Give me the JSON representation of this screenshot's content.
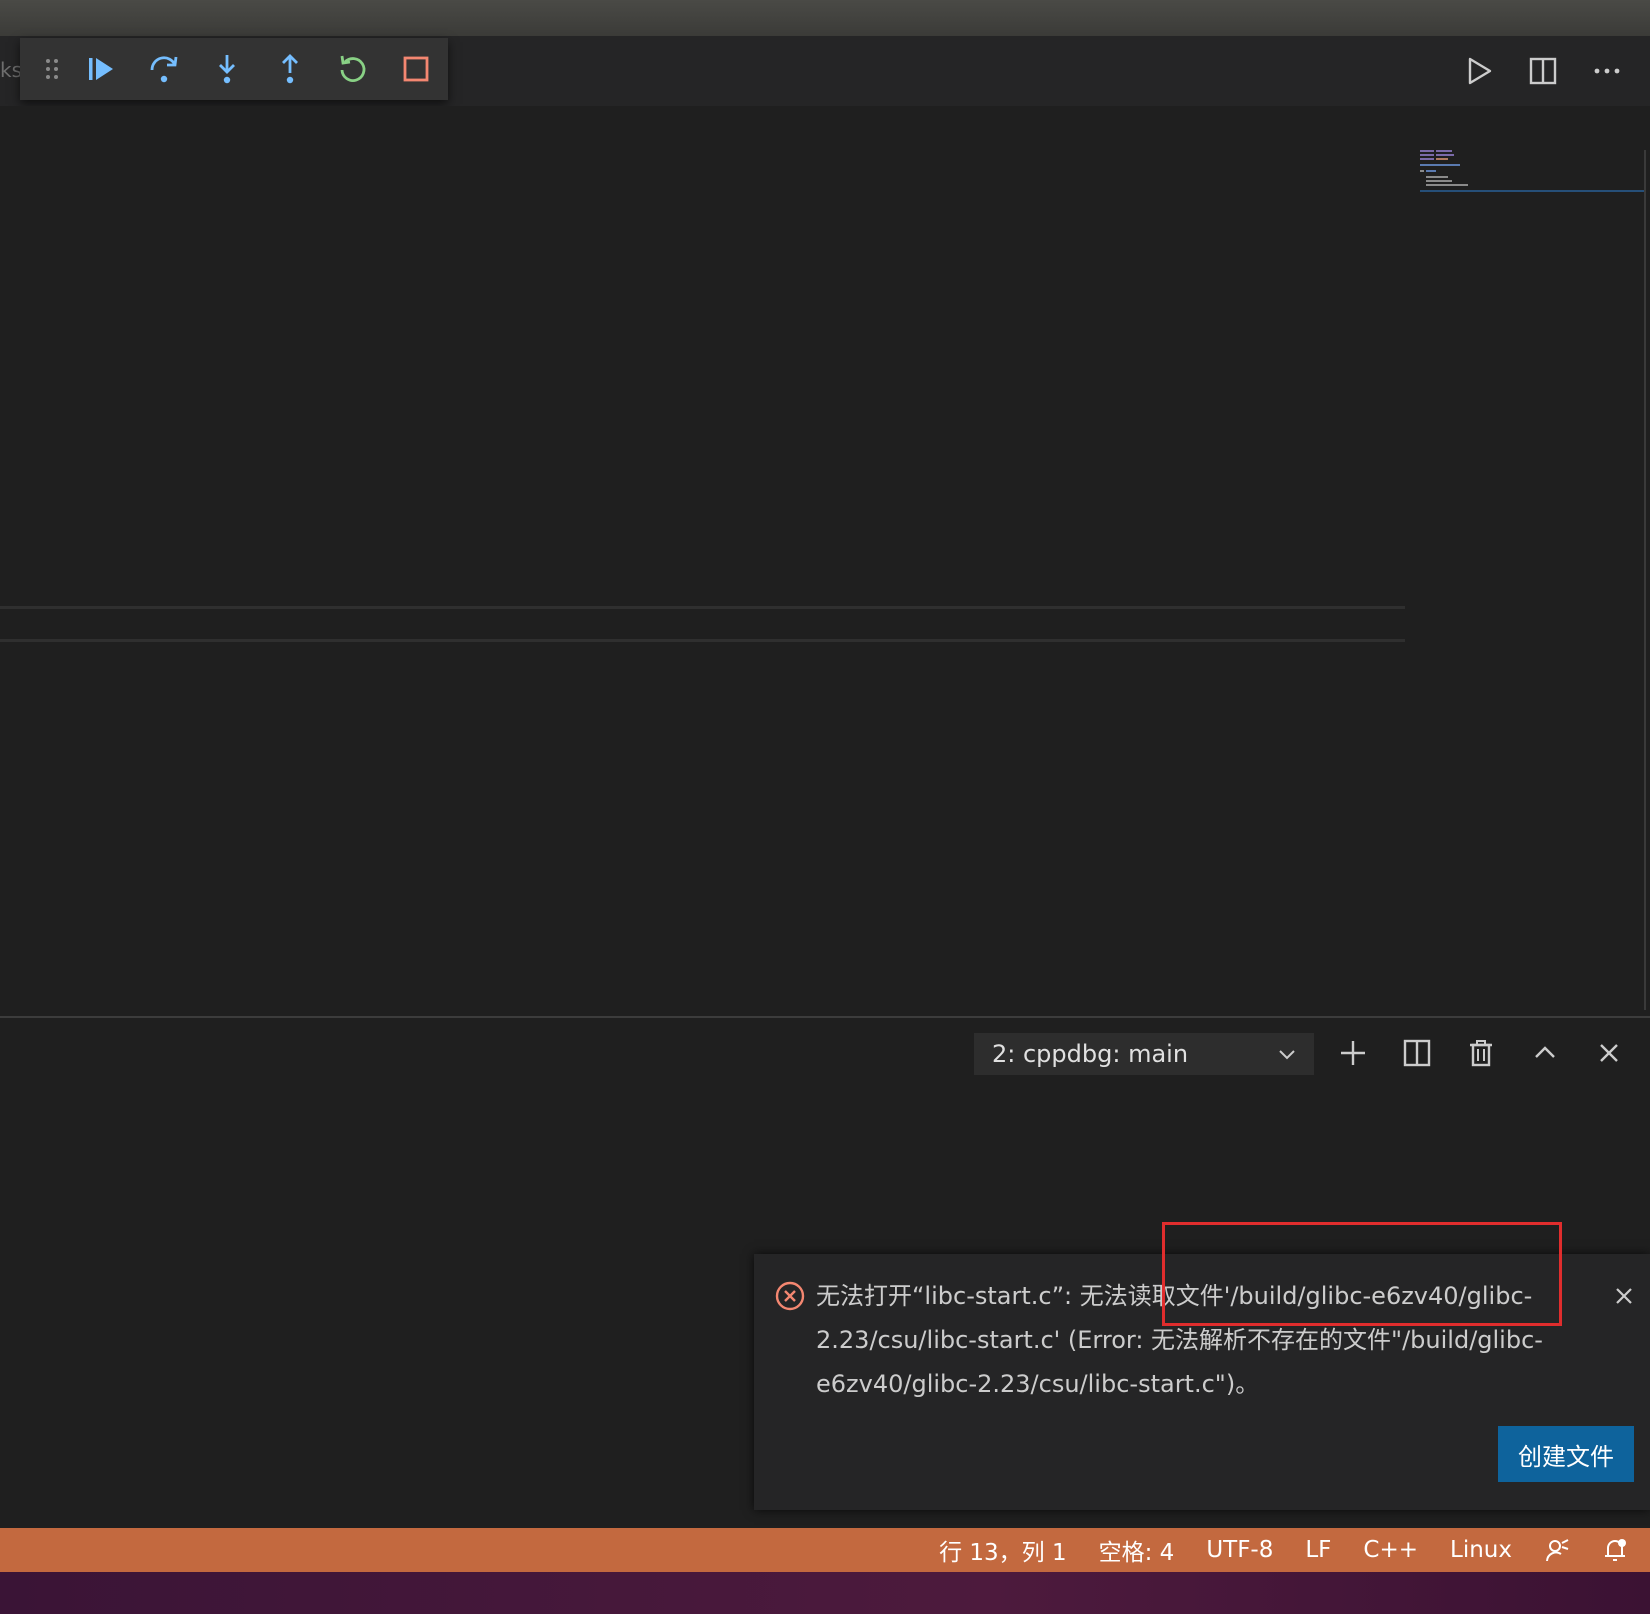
{
  "tabstrip": {
    "tab_fragment": "ks"
  },
  "debug_toolbar": {
    "buttons": [
      "drag-grip",
      "continue",
      "step-over",
      "step-into",
      "step-out",
      "restart",
      "stop"
    ]
  },
  "editor_actions": [
    "run-icon",
    "split-editor-icon",
    "more-actions-icon"
  ],
  "terminal": {
    "selected": "2: cppdbg: main",
    "actions": [
      "new-terminal",
      "split-terminal",
      "kill-terminal",
      "maximize-panel",
      "close-panel"
    ]
  },
  "notification": {
    "message": "无法打开“libc-start.c”: 无法读取文件'/build/glibc-e6zv40/glibc-2.23/csu/libc-start.c' (Error: 无法解析不存在的文件\"/build/glibc-e6zv40/glibc-2.23/csu/libc-start.c\")。",
    "button_label": "创建文件"
  },
  "statusbar": {
    "position": "行 13，列 1",
    "spaces": "空格: 4",
    "encoding": "UTF-8",
    "eol": "LF",
    "language": "C++",
    "platform": "Linux"
  },
  "colors": {
    "statusbar_bg": "#c3693f",
    "debug_blue": "#75beff",
    "restart_green": "#89d185",
    "stop_orange": "#f48771",
    "button_blue": "#0e639c",
    "highlight_red": "#e02d2d"
  }
}
